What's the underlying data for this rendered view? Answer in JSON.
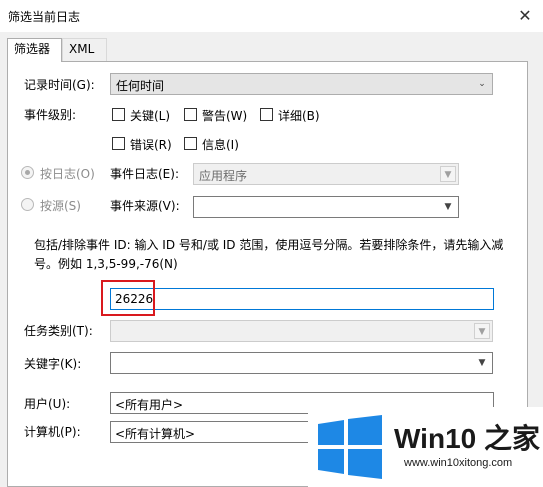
{
  "window": {
    "title": "筛选当前日志"
  },
  "tabs": [
    {
      "label": "筛选器"
    },
    {
      "label": "XML"
    }
  ],
  "logged": {
    "label": "记录时间(G):",
    "value": "任何时间"
  },
  "event_level": {
    "label": "事件级别:",
    "options": [
      {
        "label": "关键(L)"
      },
      {
        "label": "警告(W)"
      },
      {
        "label": "详细(B)"
      },
      {
        "label": "错误(R)"
      },
      {
        "label": "信息(I)"
      }
    ]
  },
  "by_log": {
    "label": "按日志(O)",
    "field_label": "事件日志(E):",
    "value": "应用程序"
  },
  "by_source": {
    "label": "按源(S)",
    "field_label": "事件来源(V):",
    "value": ""
  },
  "event_id": {
    "description": "包括/排除事件 ID: 输入 ID 号和/或 ID 范围，使用逗号分隔。若要排除条件，请先输入减号。例如 1,3,5-99,-76(N)",
    "value": "26226"
  },
  "task_category": {
    "label": "任务类别(T):",
    "value": ""
  },
  "keywords": {
    "label": "关键字(K):",
    "value": ""
  },
  "user": {
    "label": "用户(U):",
    "value": "<所有用户>"
  },
  "computer": {
    "label": "计算机(P):",
    "value": "<所有计算机>"
  },
  "watermark": {
    "brand": "Win10 之家",
    "url": "www.win10xitong.com"
  },
  "colors": {
    "highlight": "#d9191e",
    "focus": "#0078d7",
    "logo_blue": "#1e88e5"
  }
}
